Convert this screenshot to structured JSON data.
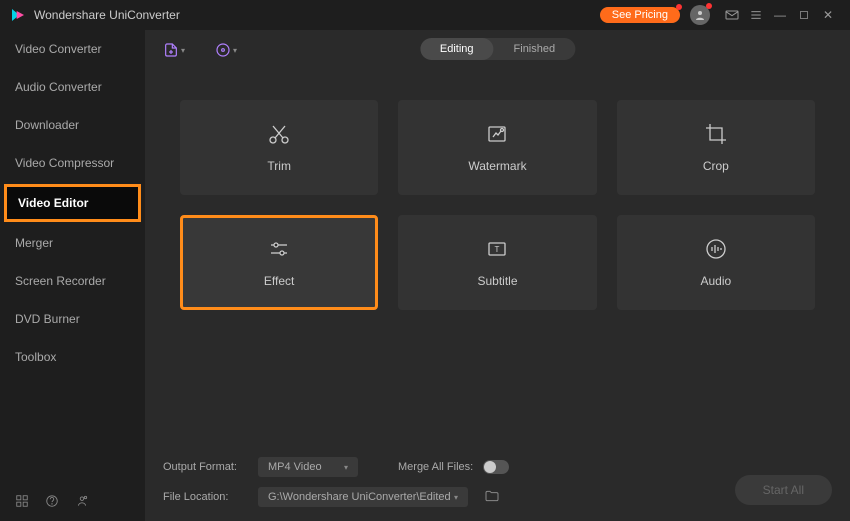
{
  "app": {
    "title": "Wondershare UniConverter"
  },
  "titlebar": {
    "pricing": "See Pricing"
  },
  "sidebar": {
    "items": [
      {
        "label": "Video Converter"
      },
      {
        "label": "Audio Converter"
      },
      {
        "label": "Downloader"
      },
      {
        "label": "Video Compressor"
      },
      {
        "label": "Video Editor",
        "active": true
      },
      {
        "label": "Merger"
      },
      {
        "label": "Screen Recorder"
      },
      {
        "label": "DVD Burner"
      },
      {
        "label": "Toolbox"
      }
    ]
  },
  "tabs": {
    "editing": "Editing",
    "finished": "Finished"
  },
  "tiles": {
    "trim": "Trim",
    "watermark": "Watermark",
    "crop": "Crop",
    "effect": "Effect",
    "subtitle": "Subtitle",
    "audio": "Audio"
  },
  "footer": {
    "output_label": "Output Format:",
    "output_value": "MP4 Video",
    "merge_label": "Merge All Files:",
    "location_label": "File Location:",
    "location_value": "G:\\Wondershare UniConverter\\Edited",
    "start": "Start All"
  }
}
